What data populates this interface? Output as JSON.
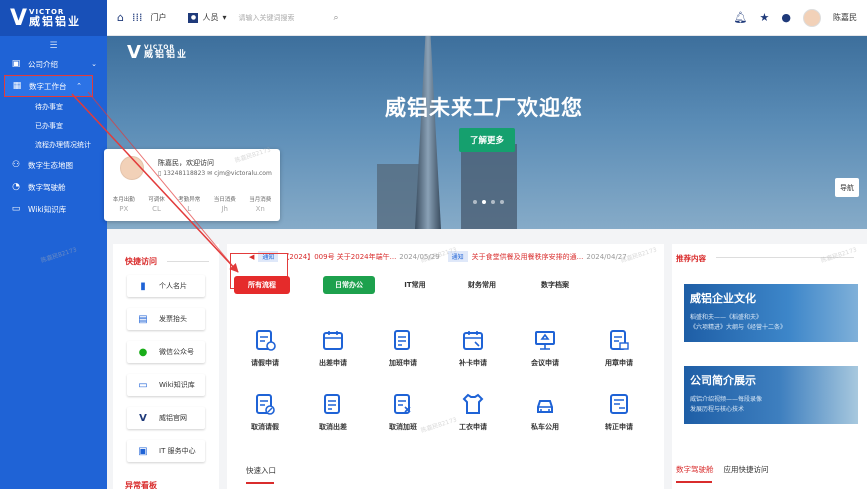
{
  "logo": {
    "en": "VICTOR",
    "cn": "威铝铝业"
  },
  "sidebar": {
    "collapse": "☰",
    "items": [
      {
        "label": "公司介绍",
        "has_chevron": true
      },
      {
        "label": "数字工作台",
        "has_chevron": true
      },
      {
        "label": "待办事宜"
      },
      {
        "label": "已办事宜"
      },
      {
        "label": "流程办理情况统计"
      },
      {
        "label": "数字生态地图"
      },
      {
        "label": "数字驾驶舱"
      },
      {
        "label": "Wiki知识库"
      }
    ]
  },
  "topbar": {
    "portal": "门户",
    "select_label": "人员",
    "search_placeholder": "请输入关键词搜索",
    "user_name": "陈嘉民"
  },
  "banner": {
    "logo_en": "VICTOR",
    "logo_cn": "威铝铝业",
    "title": "威铝未来工厂欢迎您",
    "button": "了解更多",
    "nav": "导航"
  },
  "profile": {
    "greeting": "陈嘉民，欢迎访问",
    "phone": "13248118823",
    "email": "cjm@victoralu.com",
    "stats": [
      {
        "label": "本月出勤",
        "value": "PX"
      },
      {
        "label": "可调休",
        "value": "CL"
      },
      {
        "label": "考勤异常",
        "value": "L"
      },
      {
        "label": "当日消费",
        "value": "Jh"
      },
      {
        "label": "当月消费",
        "value": "Xn"
      }
    ]
  },
  "quick": {
    "title": "快捷访问",
    "items": [
      {
        "label": "个人名片"
      },
      {
        "label": "发票抬头"
      },
      {
        "label": "微信公众号"
      },
      {
        "label": "Wiki知识库"
      },
      {
        "label": "威铝官网"
      },
      {
        "label": "IT 服务中心"
      }
    ],
    "title2": "异常看板"
  },
  "main": {
    "notices": [
      {
        "tag": "通知",
        "text": "【2024】009号 关于2024年端午...",
        "date": "2024/05/29"
      },
      {
        "tag": "通知",
        "text": "关于食堂供餐及用餐秩序安排的通...",
        "date": "2024/04/27"
      }
    ],
    "tabs": [
      "所有流程",
      "日常办公",
      "IT常用",
      "财务常用",
      "数字档案"
    ],
    "apps": [
      {
        "label": "请假申请"
      },
      {
        "label": "出差申请"
      },
      {
        "label": "加班申请"
      },
      {
        "label": "补卡申请"
      },
      {
        "label": "会议申请"
      },
      {
        "label": "用章申请"
      },
      {
        "label": "取消请假"
      },
      {
        "label": "取消出差"
      },
      {
        "label": "取消加班"
      },
      {
        "label": "工衣申请"
      },
      {
        "label": "私车公用"
      },
      {
        "label": "转正申请"
      }
    ],
    "quick_entry": "快速入口"
  },
  "right": {
    "title": "推荐内容",
    "card1_title": "威铝企业文化",
    "card1_sub1": "稻盛和夫——《稻盛和夫》",
    "card1_sub2": "《六项精进》大纲与《经营十二条》",
    "card2_title": "公司简介展示",
    "card2_sub1": "威铝介绍视频——每段录像",
    "card2_sub2": "发展历程与核心技术",
    "tab1": "数字驾驶舱",
    "tab2": "应用快捷访问"
  },
  "watermark": "陈嘉民82173"
}
